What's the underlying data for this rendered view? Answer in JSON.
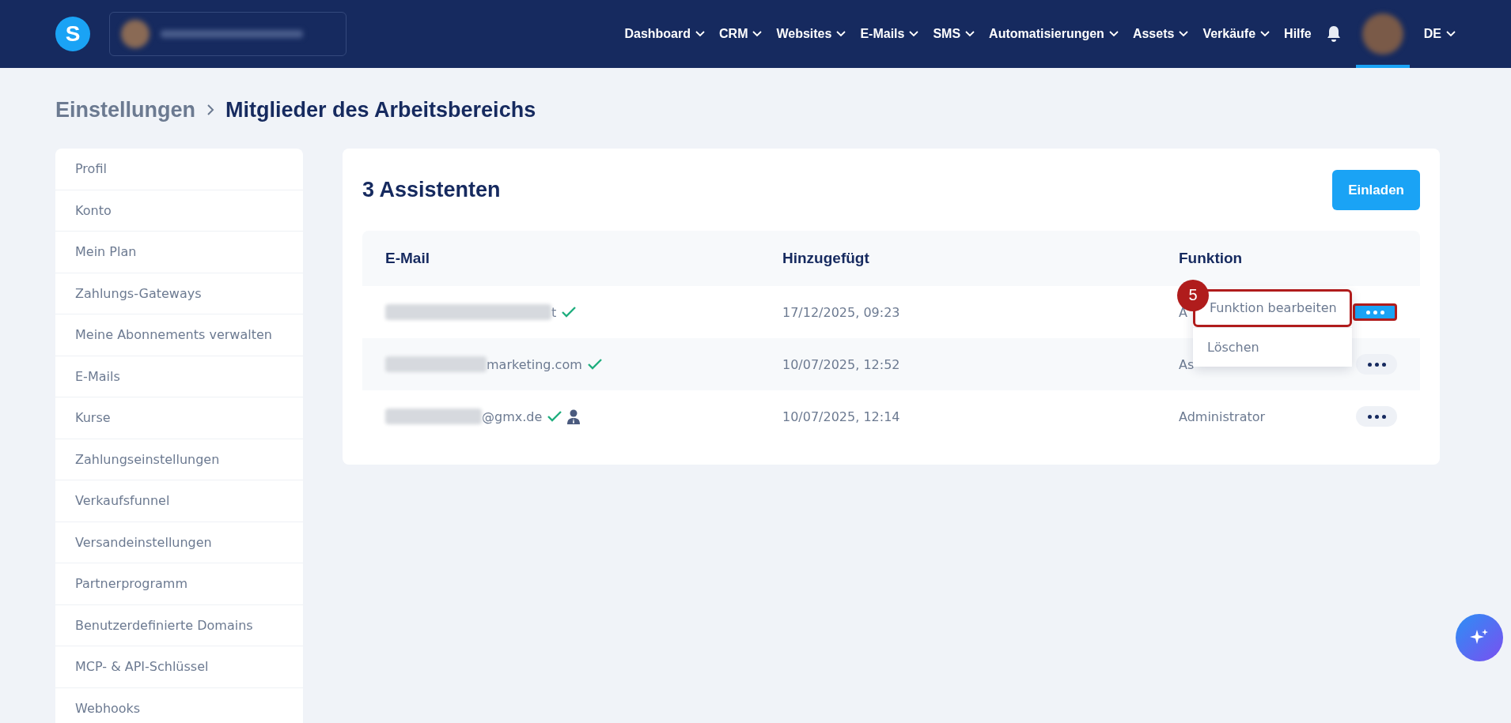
{
  "header": {
    "logo": "S",
    "nav": [
      {
        "label": "Dashboard",
        "caret": true
      },
      {
        "label": "CRM",
        "caret": true
      },
      {
        "label": "Websites",
        "caret": true
      },
      {
        "label": "E-Mails",
        "caret": true
      },
      {
        "label": "SMS",
        "caret": true
      },
      {
        "label": "Automatisierungen",
        "caret": true
      },
      {
        "label": "Assets",
        "caret": true
      },
      {
        "label": "Verkäufe",
        "caret": true
      },
      {
        "label": "Hilfe",
        "caret": false
      }
    ],
    "language": "DE"
  },
  "breadcrumb": {
    "parent": "Einstellungen",
    "current": "Mitglieder des Arbeitsbereichs"
  },
  "sidebar": {
    "items": [
      "Profil",
      "Konto",
      "Mein Plan",
      "Zahlungs-Gateways",
      "Meine Abonnements verwalten",
      "E-Mails",
      "Kurse",
      "Zahlungseinstellungen",
      "Verkaufsfunnel",
      "Versandeinstellungen",
      "Partnerprogramm",
      "Benutzerdefinierte Domains",
      "MCP- & API-Schlüssel",
      "Webhooks"
    ]
  },
  "members": {
    "title": "3 Assistenten",
    "invite_button": "Einladen",
    "columns": [
      "E-Mail",
      "Hinzugefügt",
      "Funktion"
    ],
    "rows": [
      {
        "email_visible": "t",
        "verified": true,
        "owner": false,
        "added": "17/12/2025, 09:23",
        "role": "A",
        "menu_open": true
      },
      {
        "email_visible": "marketing.com",
        "verified": true,
        "owner": false,
        "added": "10/07/2025, 12:52",
        "role": "As",
        "menu_open": false
      },
      {
        "email_visible": "@gmx.de",
        "verified": true,
        "owner": true,
        "added": "10/07/2025, 12:14",
        "role": "Administrator",
        "menu_open": false
      }
    ],
    "menu": {
      "step": "5",
      "items": [
        {
          "label": "Funktion bearbeiten",
          "highlighted": true
        },
        {
          "label": "Löschen",
          "highlighted": false
        }
      ]
    }
  }
}
